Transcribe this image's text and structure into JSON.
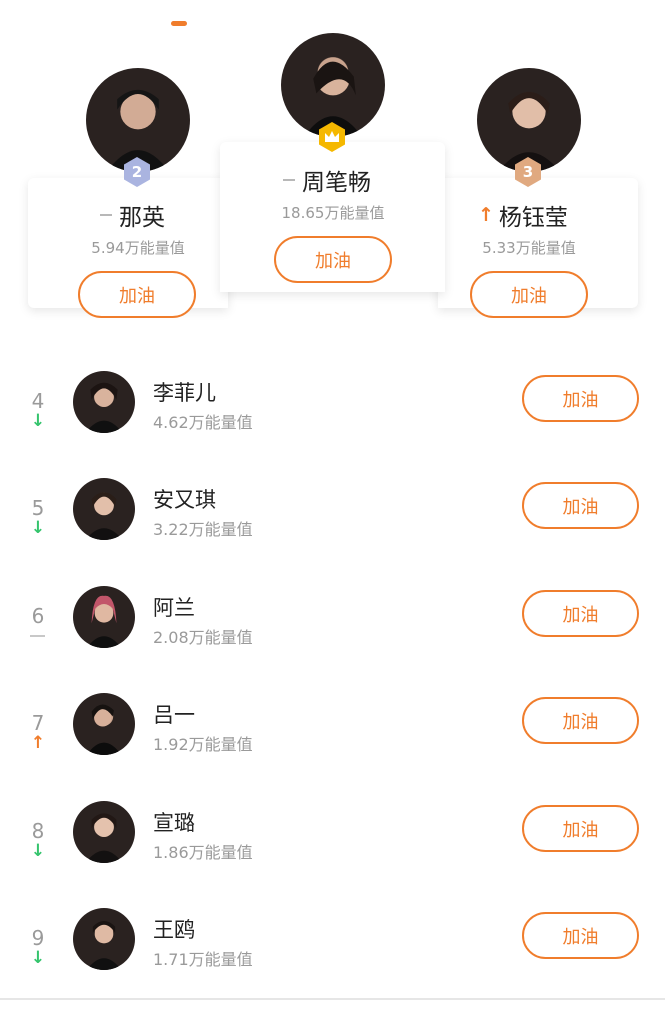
{
  "colors": {
    "accent": "#f07d2c",
    "down": "#35c46d",
    "flat": "#b8b8b8",
    "gold": "#f5b800",
    "silver": "#aab4e0",
    "bronze": "#e0a980"
  },
  "podium": [
    {
      "rank": "2",
      "name": "那英",
      "energy": "5.94万能量值",
      "trend": "flat",
      "button": "加油"
    },
    {
      "rank": "1",
      "name": "周笔畅",
      "energy": "18.65万能量值",
      "trend": "flat",
      "button": "加油",
      "badge_icon": "crown-icon"
    },
    {
      "rank": "3",
      "name": "杨钰莹",
      "energy": "5.33万能量值",
      "trend": "up",
      "button": "加油"
    }
  ],
  "list": [
    {
      "rank": "4",
      "name": "李菲儿",
      "energy": "4.62万能量值",
      "trend": "down",
      "button": "加油"
    },
    {
      "rank": "5",
      "name": "安又琪",
      "energy": "3.22万能量值",
      "trend": "down",
      "button": "加油"
    },
    {
      "rank": "6",
      "name": "阿兰",
      "energy": "2.08万能量值",
      "trend": "flat",
      "button": "加油"
    },
    {
      "rank": "7",
      "name": "吕一",
      "energy": "1.92万能量值",
      "trend": "up",
      "button": "加油"
    },
    {
      "rank": "8",
      "name": "宣璐",
      "energy": "1.86万能量值",
      "trend": "down",
      "button": "加油"
    },
    {
      "rank": "9",
      "name": "王鸥",
      "energy": "1.71万能量值",
      "trend": "down",
      "button": "加油"
    }
  ],
  "icons": {
    "up": "arrow-up-icon",
    "down": "arrow-down-icon",
    "flat": "dash-icon"
  }
}
